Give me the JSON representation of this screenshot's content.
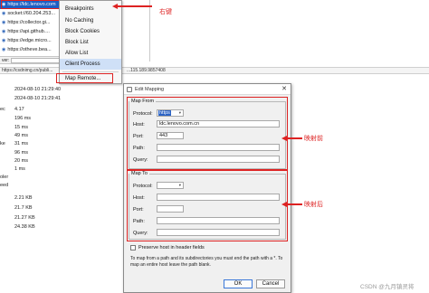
{
  "sessions": [
    {
      "text": "https://ldc.lenovo.com",
      "selected": true
    },
    {
      "text": "socket://60.204.253...",
      "selected": false
    },
    {
      "text": "https://collector.gi...",
      "selected": false
    },
    {
      "text": "https://api.github....",
      "selected": false
    },
    {
      "text": "https://edge.micro...",
      "selected": false
    },
    {
      "text": "https://otheve.bea...",
      "selected": false
    },
    {
      "text": "socket://14.71.21...",
      "selected": false
    }
  ],
  "filter_label": "ver:",
  "status_bar": {
    "left": "https://csdnimg.cn/publi...",
    "right": "...115.189.9857408"
  },
  "context_menu": {
    "items": [
      "Breakpoints",
      "No Caching",
      "Block Cookies",
      "Block List",
      "Allow List",
      "Client Process",
      "Map Remote..."
    ],
    "highlighted": "Client Process"
  },
  "annotations": {
    "right_click": "右键",
    "before_mapping": "映射前",
    "after_mapping": "映射后"
  },
  "stats": [
    {
      "k": "",
      "v": "2024-08-10 21:29:40"
    },
    {
      "k": "",
      "v": "2024-08-10 21:29:41"
    },
    {
      "k": "ec",
      "v": "4.17"
    },
    {
      "k": "",
      "v": "196 ms"
    },
    {
      "k": "",
      "v": "15 ms"
    },
    {
      "k": "",
      "v": "49 ms"
    },
    {
      "k": "ke",
      "v": "31 ms"
    },
    {
      "k": "",
      "v": "96 ms"
    },
    {
      "k": "",
      "v": "20 ms"
    },
    {
      "k": "",
      "v": "1 ms"
    },
    {
      "k": "oler",
      "v": ""
    },
    {
      "k": "eed",
      "v": ""
    },
    {
      "k": "",
      "v": "2.21 KB"
    },
    {
      "k": "",
      "v": "21.7 KB"
    },
    {
      "k": "",
      "v": "21.27 KB"
    },
    {
      "k": "",
      "v": "24.38 KB"
    }
  ],
  "dialog": {
    "title": "Edit Mapping",
    "map_from": {
      "legend": "Map From",
      "protocol_label": "Protocol:",
      "protocol_value": "https",
      "host_label": "Host:",
      "host_value": "ldc.lenovo.com.cn",
      "port_label": "Port:",
      "port_value": "443",
      "path_label": "Path:",
      "path_value": "",
      "query_label": "Query:",
      "query_value": ""
    },
    "map_to": {
      "legend": "Map To",
      "protocol_label": "Protocol:",
      "protocol_value": "",
      "host_label": "Host:",
      "host_value": "",
      "port_label": "Port:",
      "port_value": "",
      "path_label": "Path:",
      "path_value": "",
      "query_label": "Query:",
      "query_value": ""
    },
    "preserve_label": "Preserve host in header fields",
    "note_line1": "To map from a path and its subdirectories you must end the path with a *. To",
    "note_line2": "map an entire host leave the path blank.",
    "ok_label": "OK",
    "cancel_label": "Cancel"
  },
  "watermark": "CSDN @九月镇灵将",
  "colors": {
    "selection": "#1c5fc4",
    "annotation": "#dd2222",
    "dialog_bg": "#f0f0f0"
  }
}
